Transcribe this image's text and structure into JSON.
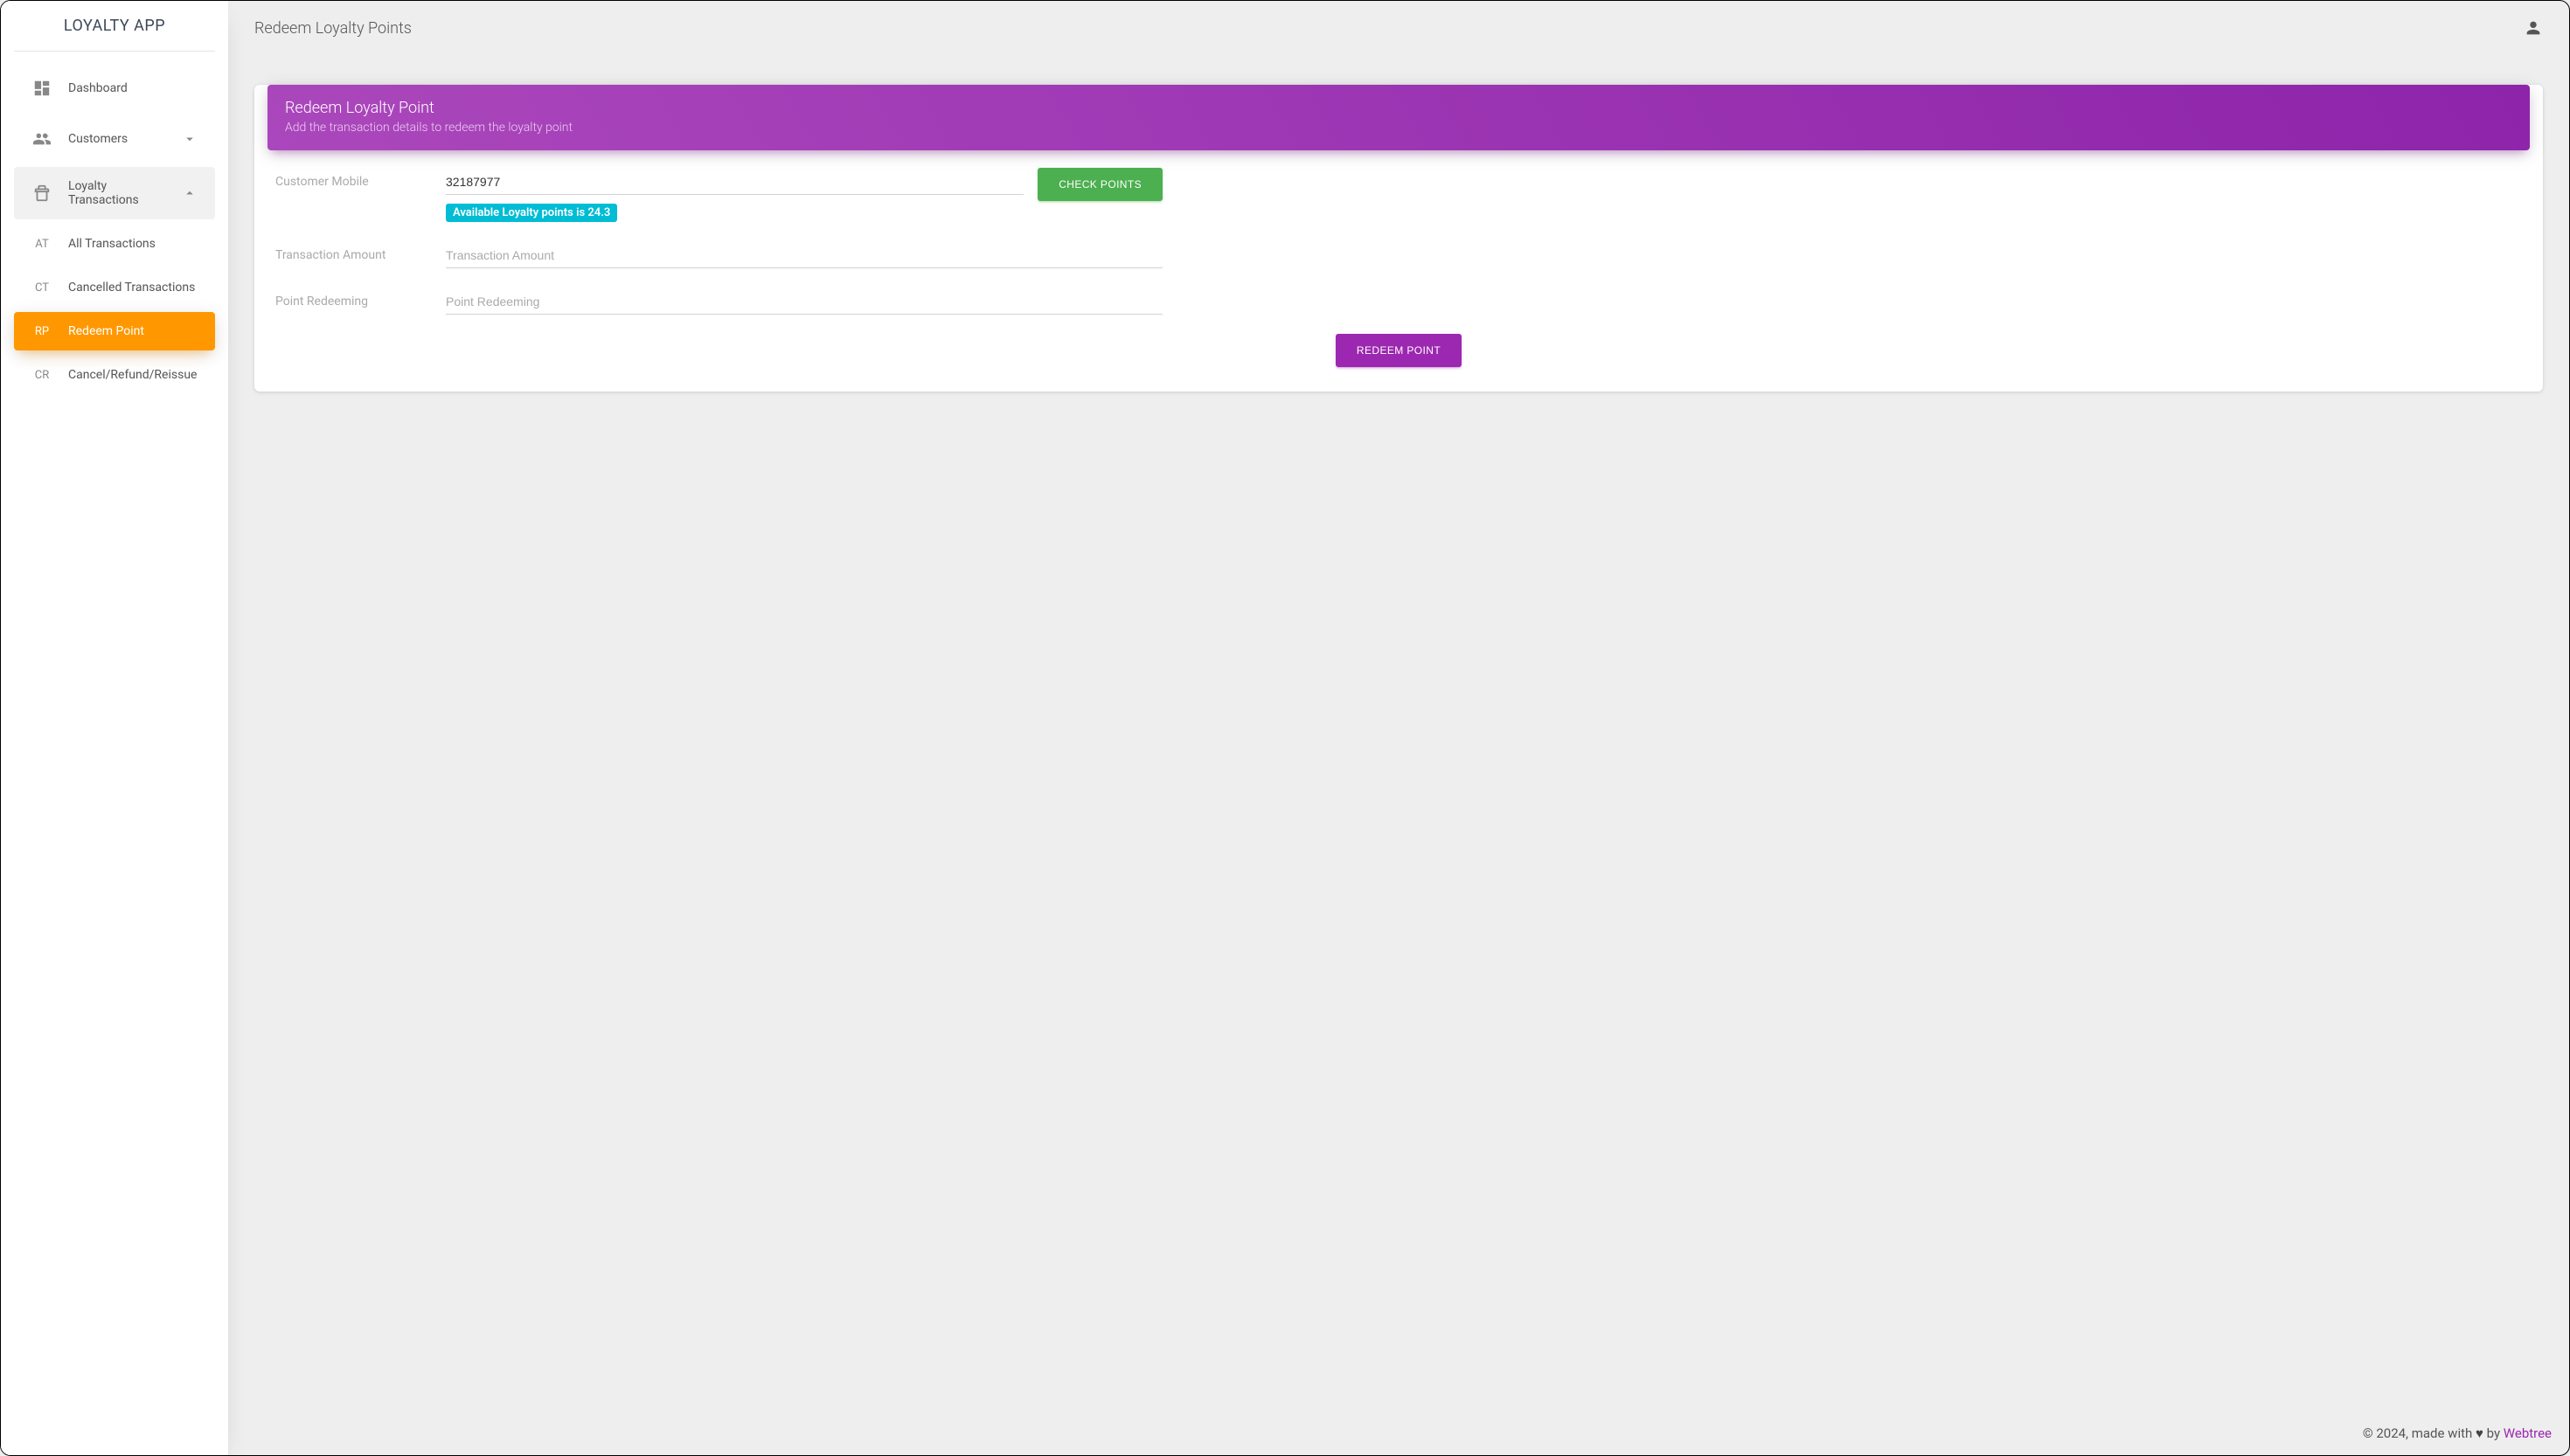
{
  "brand": "LOYALTY APP",
  "header": {
    "page_title": "Redeem Loyalty Points"
  },
  "sidebar": {
    "items": [
      {
        "icon": "dashboard",
        "label": "Dashboard"
      },
      {
        "icon": "customers",
        "label": "Customers",
        "has_children": true,
        "expanded": false
      },
      {
        "icon": "register",
        "label": "Loyalty Transactions",
        "has_children": true,
        "expanded": true
      }
    ],
    "loyalty_sub": [
      {
        "abbr": "AT",
        "label": "All Transactions",
        "active": false
      },
      {
        "abbr": "CT",
        "label": "Cancelled Transactions",
        "active": false
      },
      {
        "abbr": "RP",
        "label": "Redeem Point",
        "active": true
      },
      {
        "abbr": "CR",
        "label": "Cancel/Refund/Reissue",
        "active": false
      }
    ]
  },
  "card": {
    "title": "Redeem Loyalty Point",
    "subtitle": "Add the transaction details to redeem the loyalty point"
  },
  "form": {
    "labels": {
      "customer_mobile": "Customer Mobile",
      "transaction_amount": "Transaction Amount",
      "point_redeeming": "Point Redeeming"
    },
    "values": {
      "customer_mobile": "32187977",
      "transaction_amount": "",
      "point_redeeming": ""
    },
    "placeholders": {
      "transaction_amount": "Transaction Amount",
      "point_redeeming": "Point Redeeming"
    },
    "badge": "Available Loyalty points is 24.3",
    "buttons": {
      "check_points": "Check Points",
      "redeem_point": "Redeem Point"
    }
  },
  "footer": {
    "prefix": "© 2024, made with ",
    "by": " by ",
    "company": "Webtree"
  }
}
